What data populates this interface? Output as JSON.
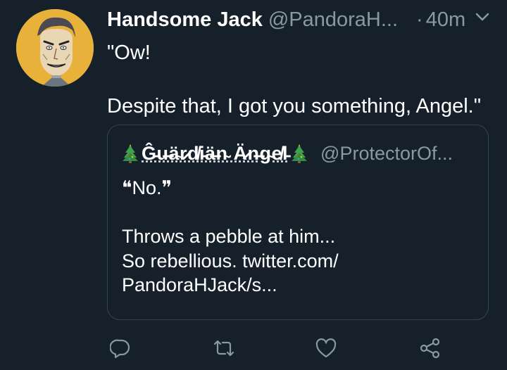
{
  "author": {
    "display_name": "Handsome Jack",
    "handle": "@PandoraH...",
    "separator": "·",
    "timestamp": "40m"
  },
  "tweet": {
    "text": "\"Ow!\n\nDespite that, I got you something, Angel.\""
  },
  "quoted_tweet": {
    "display_name": "Ĝ̵u̶ä̴r̷d̸i̵ä̶n̴ Ä̷n̶g̴e̸l̵",
    "handle": "@ProtectorOf...",
    "text": "❝No.❞\n\nThrows a pebble at him...\nSo rebellious. twitter.com/\nPandoraHJack/s..."
  },
  "icons": {
    "avatar": "avatar",
    "menu": "chevron-down-icon",
    "badge": "christmas-tree-icon",
    "reply": "reply-icon",
    "retweet": "retweet-icon",
    "like": "like-icon",
    "share": "share-icon"
  },
  "colors": {
    "background": "#15202b",
    "secondary_text": "#8899a6",
    "border": "#38444d",
    "avatar_bg": "#e8b23a"
  }
}
